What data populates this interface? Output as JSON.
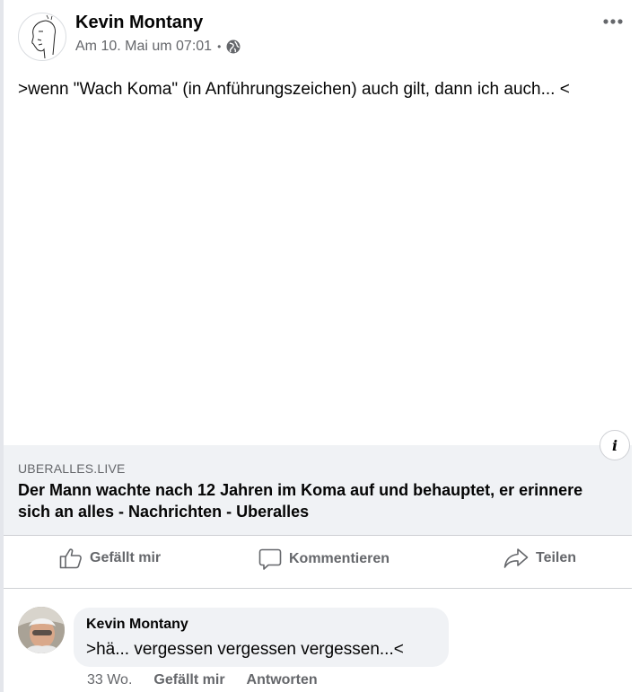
{
  "post": {
    "author": "Kevin Montany",
    "timestamp": "Am 10. Mai um 07:01",
    "separator": "•",
    "privacy_icon": "globe-icon",
    "text": ">wenn \"Wach Koma\" (in Anführungszeichen) auch gilt, dann ich auch... <"
  },
  "link_preview": {
    "domain": "UBERALLES.LIVE",
    "title": "Der Mann wachte nach 12 Jahren im Koma auf und behauptet, er erinnere sich an alles - Nachrichten - Uberalles",
    "info_icon_label": "i"
  },
  "actions": {
    "like_label": "Gefällt mir",
    "comment_label": "Kommentieren",
    "share_label": "Teilen"
  },
  "comment": {
    "author": "Kevin Montany",
    "text": ">hä... vergessen vergessen vergessen...<",
    "time": "33 Wo.",
    "like_label": "Gefällt mir",
    "reply_label": "Antworten"
  },
  "colors": {
    "secondary_text": "#65676b",
    "bubble_bg": "#f0f2f5",
    "divider": "#ced0d4"
  }
}
